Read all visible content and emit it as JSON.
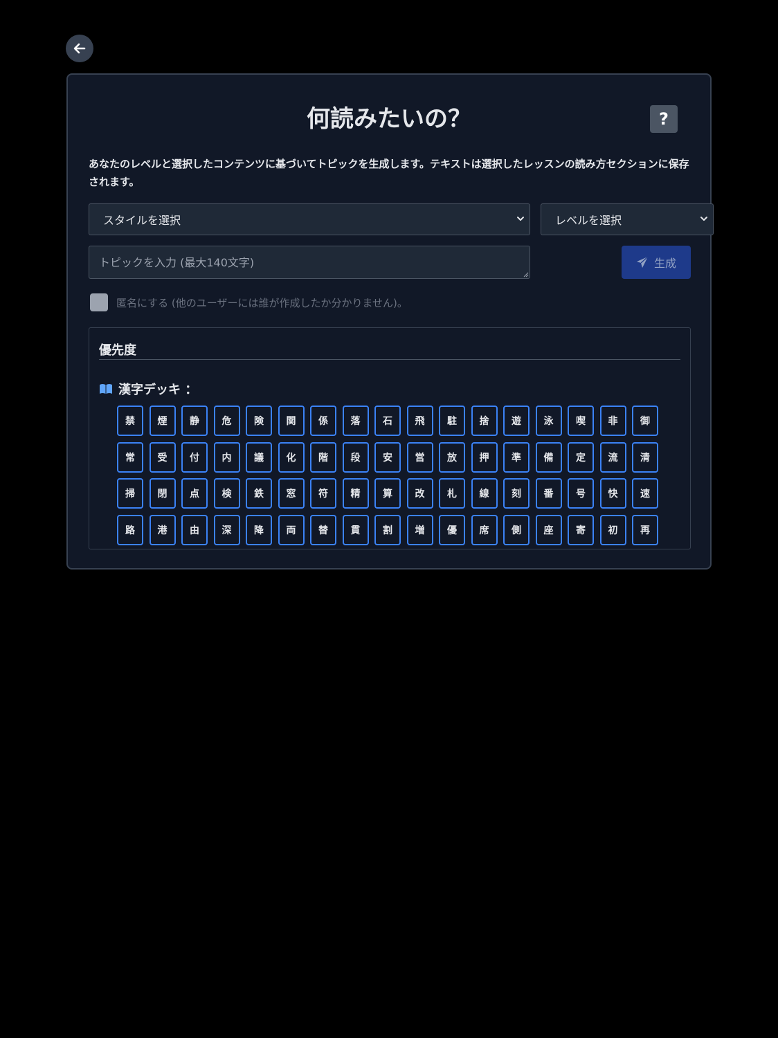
{
  "header": {
    "title": "何読みたいの？",
    "help_label": "?"
  },
  "description": "あなたのレベルと選択したコンテンツに基づいてトピックを生成します。テキストは選択したレッスンの読み方セクションに保存されます。",
  "form": {
    "style_select": "スタイルを選択",
    "level_select": "レベルを選択",
    "topic_placeholder": "トピックを入力 (最大140文字)",
    "generate_label": "生成",
    "anonymous_label": "匿名にする (他のユーザーには誰が作成したか分かりません)。"
  },
  "priority": {
    "title": "優先度",
    "deck_label": "漢字デッキ ：",
    "kanji": [
      "禁",
      "煙",
      "静",
      "危",
      "険",
      "関",
      "係",
      "落",
      "石",
      "飛",
      "駐",
      "捨",
      "遊",
      "泳",
      "喫",
      "非",
      "御",
      "常",
      "受",
      "付",
      "内",
      "議",
      "化",
      "階",
      "段",
      "安",
      "営",
      "放",
      "押",
      "準",
      "備",
      "定",
      "流",
      "清",
      "掃",
      "閉",
      "点",
      "検",
      "鉄",
      "窓",
      "符",
      "精",
      "算",
      "改",
      "札",
      "線",
      "刻",
      "番",
      "号",
      "快",
      "速",
      "路",
      "港",
      "由",
      "深",
      "降",
      "両",
      "替",
      "貫",
      "割",
      "増",
      "優",
      "席",
      "側",
      "座",
      "寄",
      "初",
      "再"
    ]
  },
  "colors": {
    "background": "#000000",
    "card": "#111827",
    "accent": "#3b82f6",
    "generate_button": "#1e3a8a"
  },
  "icons": {
    "back": "arrow-left-icon",
    "generate": "paper-plane-icon",
    "deck": "open-book-icon",
    "select": "chevron-down-icon"
  }
}
